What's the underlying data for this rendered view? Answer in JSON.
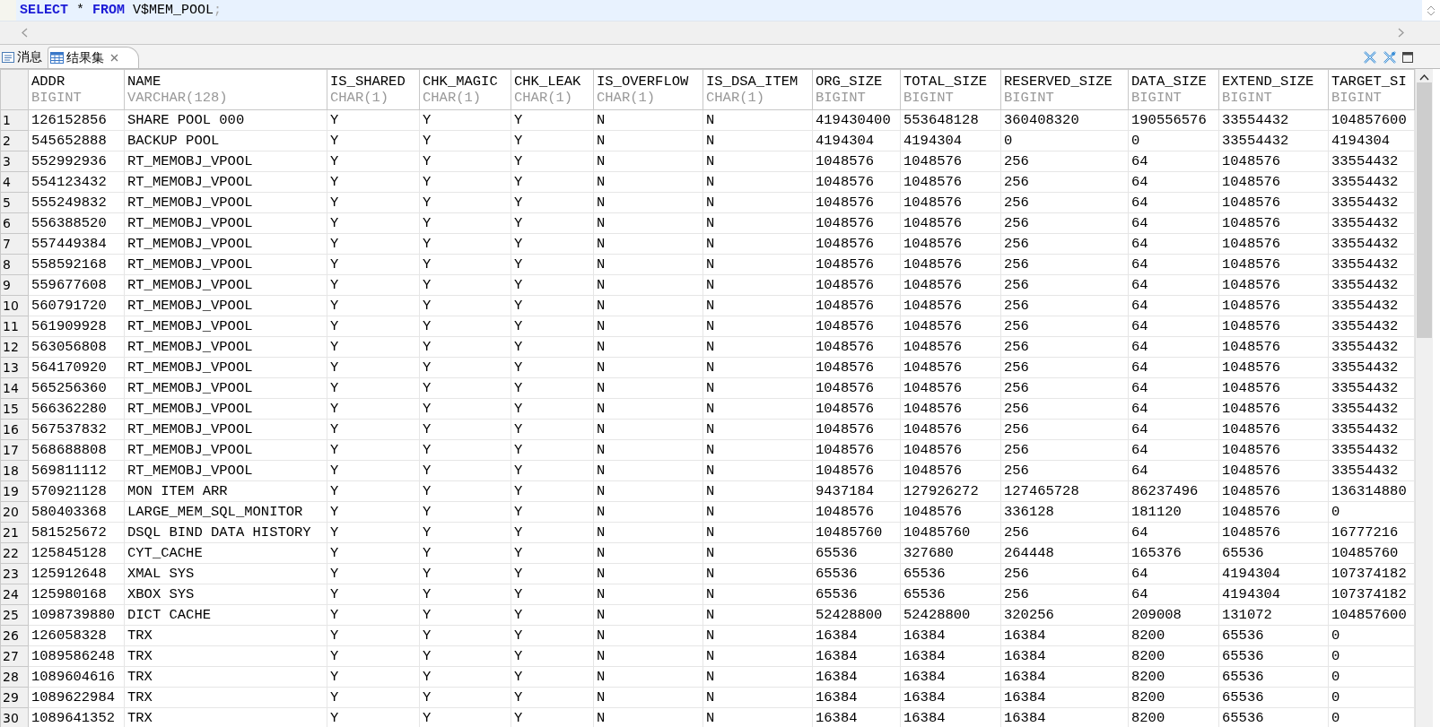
{
  "editor": {
    "sql": [
      {
        "text": "SELECT",
        "kind": "keyword"
      },
      {
        "text": " * ",
        "kind": "plain"
      },
      {
        "text": "FROM",
        "kind": "keyword"
      },
      {
        "text": " V$MEM_POOL",
        "kind": "plain"
      },
      {
        "text": ";",
        "kind": "punct"
      }
    ]
  },
  "tabs": [
    {
      "label": "消息",
      "kind": "messages",
      "selected": false,
      "closable": false
    },
    {
      "label": "结果集",
      "kind": "results",
      "selected": true,
      "closable": true
    }
  ],
  "table": {
    "columns": [
      {
        "name": "ADDR",
        "type": "BIGINT"
      },
      {
        "name": "NAME",
        "type": "VARCHAR(128)"
      },
      {
        "name": "IS_SHARED",
        "type": "CHAR(1)"
      },
      {
        "name": "CHK_MAGIC",
        "type": "CHAR(1)"
      },
      {
        "name": "CHK_LEAK",
        "type": "CHAR(1)"
      },
      {
        "name": "IS_OVERFLOW",
        "type": "CHAR(1)"
      },
      {
        "name": "IS_DSA_ITEM",
        "type": "CHAR(1)"
      },
      {
        "name": "ORG_SIZE",
        "type": "BIGINT"
      },
      {
        "name": "TOTAL_SIZE",
        "type": "BIGINT"
      },
      {
        "name": "RESERVED_SIZE",
        "type": "BIGINT"
      },
      {
        "name": "DATA_SIZE",
        "type": "BIGINT"
      },
      {
        "name": "EXTEND_SIZE",
        "type": "BIGINT"
      },
      {
        "name": "TARGET_SI",
        "type": "BIGINT"
      }
    ],
    "rows": [
      {
        "n": "1",
        "cells": [
          "126152856",
          "SHARE POOL 000",
          "Y",
          "Y",
          "Y",
          "N",
          "N",
          "419430400",
          "553648128",
          "360408320",
          "190556576",
          "33554432",
          "104857600"
        ]
      },
      {
        "n": "2",
        "cells": [
          "545652888",
          "BACKUP POOL",
          "Y",
          "Y",
          "Y",
          "N",
          "N",
          "4194304",
          "4194304",
          "0",
          "0",
          "33554432",
          "4194304"
        ]
      },
      {
        "n": "3",
        "cells": [
          "552992936",
          "RT_MEMOBJ_VPOOL",
          "Y",
          "Y",
          "Y",
          "N",
          "N",
          "1048576",
          "1048576",
          "256",
          "64",
          "1048576",
          "33554432"
        ]
      },
      {
        "n": "4",
        "cells": [
          "554123432",
          "RT_MEMOBJ_VPOOL",
          "Y",
          "Y",
          "Y",
          "N",
          "N",
          "1048576",
          "1048576",
          "256",
          "64",
          "1048576",
          "33554432"
        ]
      },
      {
        "n": "5",
        "cells": [
          "555249832",
          "RT_MEMOBJ_VPOOL",
          "Y",
          "Y",
          "Y",
          "N",
          "N",
          "1048576",
          "1048576",
          "256",
          "64",
          "1048576",
          "33554432"
        ]
      },
      {
        "n": "6",
        "cells": [
          "556388520",
          "RT_MEMOBJ_VPOOL",
          "Y",
          "Y",
          "Y",
          "N",
          "N",
          "1048576",
          "1048576",
          "256",
          "64",
          "1048576",
          "33554432"
        ]
      },
      {
        "n": "7",
        "cells": [
          "557449384",
          "RT_MEMOBJ_VPOOL",
          "Y",
          "Y",
          "Y",
          "N",
          "N",
          "1048576",
          "1048576",
          "256",
          "64",
          "1048576",
          "33554432"
        ]
      },
      {
        "n": "8",
        "cells": [
          "558592168",
          "RT_MEMOBJ_VPOOL",
          "Y",
          "Y",
          "Y",
          "N",
          "N",
          "1048576",
          "1048576",
          "256",
          "64",
          "1048576",
          "33554432"
        ]
      },
      {
        "n": "9",
        "cells": [
          "559677608",
          "RT_MEMOBJ_VPOOL",
          "Y",
          "Y",
          "Y",
          "N",
          "N",
          "1048576",
          "1048576",
          "256",
          "64",
          "1048576",
          "33554432"
        ]
      },
      {
        "n": "10",
        "cells": [
          "560791720",
          "RT_MEMOBJ_VPOOL",
          "Y",
          "Y",
          "Y",
          "N",
          "N",
          "1048576",
          "1048576",
          "256",
          "64",
          "1048576",
          "33554432"
        ]
      },
      {
        "n": "11",
        "cells": [
          "561909928",
          "RT_MEMOBJ_VPOOL",
          "Y",
          "Y",
          "Y",
          "N",
          "N",
          "1048576",
          "1048576",
          "256",
          "64",
          "1048576",
          "33554432"
        ]
      },
      {
        "n": "12",
        "cells": [
          "563056808",
          "RT_MEMOBJ_VPOOL",
          "Y",
          "Y",
          "Y",
          "N",
          "N",
          "1048576",
          "1048576",
          "256",
          "64",
          "1048576",
          "33554432"
        ]
      },
      {
        "n": "13",
        "cells": [
          "564170920",
          "RT_MEMOBJ_VPOOL",
          "Y",
          "Y",
          "Y",
          "N",
          "N",
          "1048576",
          "1048576",
          "256",
          "64",
          "1048576",
          "33554432"
        ]
      },
      {
        "n": "14",
        "cells": [
          "565256360",
          "RT_MEMOBJ_VPOOL",
          "Y",
          "Y",
          "Y",
          "N",
          "N",
          "1048576",
          "1048576",
          "256",
          "64",
          "1048576",
          "33554432"
        ]
      },
      {
        "n": "15",
        "cells": [
          "566362280",
          "RT_MEMOBJ_VPOOL",
          "Y",
          "Y",
          "Y",
          "N",
          "N",
          "1048576",
          "1048576",
          "256",
          "64",
          "1048576",
          "33554432"
        ]
      },
      {
        "n": "16",
        "cells": [
          "567537832",
          "RT_MEMOBJ_VPOOL",
          "Y",
          "Y",
          "Y",
          "N",
          "N",
          "1048576",
          "1048576",
          "256",
          "64",
          "1048576",
          "33554432"
        ]
      },
      {
        "n": "17",
        "cells": [
          "568688808",
          "RT_MEMOBJ_VPOOL",
          "Y",
          "Y",
          "Y",
          "N",
          "N",
          "1048576",
          "1048576",
          "256",
          "64",
          "1048576",
          "33554432"
        ]
      },
      {
        "n": "18",
        "cells": [
          "569811112",
          "RT_MEMOBJ_VPOOL",
          "Y",
          "Y",
          "Y",
          "N",
          "N",
          "1048576",
          "1048576",
          "256",
          "64",
          "1048576",
          "33554432"
        ]
      },
      {
        "n": "19",
        "cells": [
          "570921128",
          "MON ITEM ARR",
          "Y",
          "Y",
          "Y",
          "N",
          "N",
          "9437184",
          "127926272",
          "127465728",
          "86237496",
          "1048576",
          "136314880"
        ]
      },
      {
        "n": "20",
        "cells": [
          "580403368",
          "LARGE_MEM_SQL_MONITOR",
          "Y",
          "Y",
          "Y",
          "N",
          "N",
          "1048576",
          "1048576",
          "336128",
          "181120",
          "1048576",
          "0"
        ]
      },
      {
        "n": "21",
        "cells": [
          "581525672",
          "DSQL BIND DATA HISTORY",
          "Y",
          "Y",
          "Y",
          "N",
          "N",
          "10485760",
          "10485760",
          "256",
          "64",
          "1048576",
          "16777216"
        ]
      },
      {
        "n": "22",
        "cells": [
          "125845128",
          "CYT_CACHE",
          "Y",
          "Y",
          "Y",
          "N",
          "N",
          "65536",
          "327680",
          "264448",
          "165376",
          "65536",
          "10485760"
        ]
      },
      {
        "n": "23",
        "cells": [
          "125912648",
          "XMAL SYS",
          "Y",
          "Y",
          "Y",
          "N",
          "N",
          "65536",
          "65536",
          "256",
          "64",
          "4194304",
          "107374182"
        ]
      },
      {
        "n": "24",
        "cells": [
          "125980168",
          "XBOX SYS",
          "Y",
          "Y",
          "Y",
          "N",
          "N",
          "65536",
          "65536",
          "256",
          "64",
          "4194304",
          "107374182"
        ]
      },
      {
        "n": "25",
        "cells": [
          "1098739880",
          "DICT CACHE",
          "Y",
          "Y",
          "Y",
          "N",
          "N",
          "52428800",
          "52428800",
          "320256",
          "209008",
          "131072",
          "104857600"
        ]
      },
      {
        "n": "26",
        "cells": [
          "126058328",
          "TRX",
          "Y",
          "Y",
          "Y",
          "N",
          "N",
          "16384",
          "16384",
          "16384",
          "8200",
          "65536",
          "0"
        ]
      },
      {
        "n": "27",
        "cells": [
          "1089586248",
          "TRX",
          "Y",
          "Y",
          "Y",
          "N",
          "N",
          "16384",
          "16384",
          "16384",
          "8200",
          "65536",
          "0"
        ]
      },
      {
        "n": "28",
        "cells": [
          "1089604616",
          "TRX",
          "Y",
          "Y",
          "Y",
          "N",
          "N",
          "16384",
          "16384",
          "16384",
          "8200",
          "65536",
          "0"
        ]
      },
      {
        "n": "29",
        "cells": [
          "1089622984",
          "TRX",
          "Y",
          "Y",
          "Y",
          "N",
          "N",
          "16384",
          "16384",
          "16384",
          "8200",
          "65536",
          "0"
        ]
      },
      {
        "n": "30",
        "cells": [
          "1089641352",
          "TRX",
          "Y",
          "Y",
          "Y",
          "N",
          "N",
          "16384",
          "16384",
          "16384",
          "8200",
          "65536",
          "0"
        ]
      }
    ]
  }
}
